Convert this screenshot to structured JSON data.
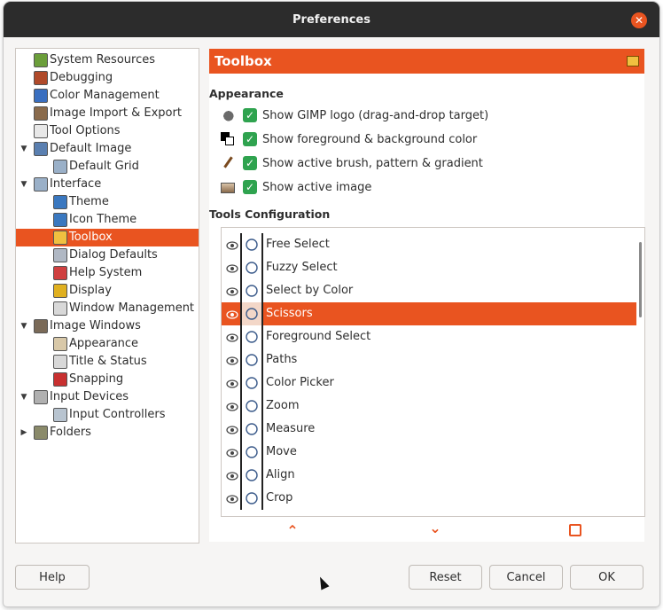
{
  "window": {
    "title": "Preferences"
  },
  "sidebar": {
    "items": [
      {
        "label": "System Resources",
        "level": 0,
        "expander": "",
        "icon": "system-resources-icon"
      },
      {
        "label": "Debugging",
        "level": 0,
        "expander": "",
        "icon": "debugging-icon"
      },
      {
        "label": "Color Management",
        "level": 0,
        "expander": "",
        "icon": "color-management-icon"
      },
      {
        "label": "Image Import & Export",
        "level": 0,
        "expander": "",
        "icon": "image-import-export-icon"
      },
      {
        "label": "Tool Options",
        "level": 0,
        "expander": "",
        "icon": "tool-options-icon"
      },
      {
        "label": "Default Image",
        "level": 0,
        "expander": "down",
        "icon": "default-image-icon"
      },
      {
        "label": "Default Grid",
        "level": 1,
        "expander": "",
        "icon": "default-grid-icon"
      },
      {
        "label": "Interface",
        "level": 0,
        "expander": "down",
        "icon": "interface-icon"
      },
      {
        "label": "Theme",
        "level": 1,
        "expander": "",
        "icon": "theme-icon"
      },
      {
        "label": "Icon Theme",
        "level": 1,
        "expander": "",
        "icon": "icon-theme-icon"
      },
      {
        "label": "Toolbox",
        "level": 1,
        "expander": "",
        "icon": "toolbox-icon",
        "selected": true
      },
      {
        "label": "Dialog Defaults",
        "level": 1,
        "expander": "",
        "icon": "dialog-defaults-icon"
      },
      {
        "label": "Help System",
        "level": 1,
        "expander": "",
        "icon": "help-system-icon"
      },
      {
        "label": "Display",
        "level": 1,
        "expander": "",
        "icon": "display-icon"
      },
      {
        "label": "Window Management",
        "level": 1,
        "expander": "",
        "icon": "window-management-icon"
      },
      {
        "label": "Image Windows",
        "level": 0,
        "expander": "down",
        "icon": "image-windows-icon"
      },
      {
        "label": "Appearance",
        "level": 1,
        "expander": "",
        "icon": "appearance-icon"
      },
      {
        "label": "Title & Status",
        "level": 1,
        "expander": "",
        "icon": "title-status-icon"
      },
      {
        "label": "Snapping",
        "level": 1,
        "expander": "",
        "icon": "snapping-icon"
      },
      {
        "label": "Input Devices",
        "level": 0,
        "expander": "down",
        "icon": "input-devices-icon"
      },
      {
        "label": "Input Controllers",
        "level": 1,
        "expander": "",
        "icon": "input-controllers-icon"
      },
      {
        "label": "Folders",
        "level": 0,
        "expander": "right",
        "icon": "folders-icon"
      }
    ]
  },
  "page": {
    "title": "Toolbox",
    "header_icon": "toolbox-icon"
  },
  "appearance": {
    "title": "Appearance",
    "options": [
      {
        "label": "Show GIMP logo (drag-and-drop target)",
        "checked": true,
        "icon": "gimp-logo-icon"
      },
      {
        "label": "Show foreground & background color",
        "checked": true,
        "icon": "fg-bg-color-icon"
      },
      {
        "label": "Show active brush, pattern & gradient",
        "checked": true,
        "icon": "brush-icon"
      },
      {
        "label": "Show active image",
        "checked": true,
        "icon": "active-image-icon"
      }
    ]
  },
  "tools_config": {
    "title": "Tools Configuration",
    "tools": [
      {
        "label": "Free Select",
        "visible": true,
        "icon": "free-select-icon"
      },
      {
        "label": "Fuzzy Select",
        "visible": true,
        "icon": "fuzzy-select-icon"
      },
      {
        "label": "Select by Color",
        "visible": true,
        "icon": "select-by-color-icon"
      },
      {
        "label": "Scissors",
        "visible": true,
        "icon": "scissors-icon",
        "selected": true
      },
      {
        "label": "Foreground Select",
        "visible": true,
        "icon": "foreground-select-icon"
      },
      {
        "label": "Paths",
        "visible": true,
        "icon": "paths-icon"
      },
      {
        "label": "Color Picker",
        "visible": true,
        "icon": "color-picker-icon"
      },
      {
        "label": "Zoom",
        "visible": true,
        "icon": "zoom-icon"
      },
      {
        "label": "Measure",
        "visible": true,
        "icon": "measure-icon"
      },
      {
        "label": "Move",
        "visible": true,
        "icon": "move-icon"
      },
      {
        "label": "Align",
        "visible": true,
        "icon": "align-icon"
      },
      {
        "label": "Crop",
        "visible": true,
        "icon": "crop-icon"
      }
    ]
  },
  "list_actions": {
    "up_icon": "chevron-up-icon",
    "down_icon": "chevron-down-icon",
    "reset_icon": "reset-icon"
  },
  "buttons": {
    "help": "Help",
    "reset": "Reset",
    "cancel": "Cancel",
    "ok": "OK"
  },
  "colors": {
    "accent": "#e95420",
    "titlebar": "#2c2c2c",
    "checkbox": "#2fa34f"
  }
}
